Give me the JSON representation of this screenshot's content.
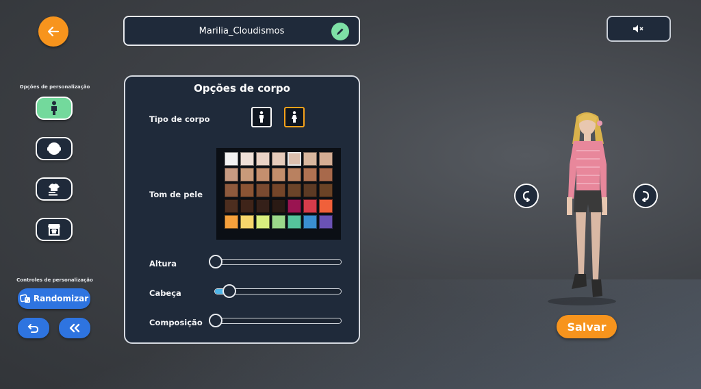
{
  "header": {
    "back_icon": "arrow-left-icon",
    "username": "Marilia_Cloudismos",
    "edit_icon": "pencil-icon",
    "mute_icon": "speaker-muted-icon"
  },
  "sidebar": {
    "options_title": "Opções de personalização",
    "items": [
      {
        "icon": "body-icon",
        "active": true
      },
      {
        "icon": "head-icon",
        "active": false
      },
      {
        "icon": "clothing-icon",
        "active": false
      },
      {
        "icon": "store-icon",
        "active": false
      }
    ],
    "controls_title": "Controles de personalização",
    "randomize_label": "Randomizar",
    "undo_icon": "undo-icon",
    "collapse_icon": "double-chevron-left-icon"
  },
  "panel": {
    "title": "Opções de corpo",
    "body_type_label": "Tipo de corpo",
    "body_types": [
      {
        "icon": "male-figure-icon",
        "selected": false
      },
      {
        "icon": "female-figure-icon",
        "selected": true
      }
    ],
    "skin_tone_label": "Tom de pele",
    "skin_tones": [
      "#f2f2f2",
      "#efe0d8",
      "#ead3c6",
      "#e5cbbb",
      "#dcbfae",
      "#d8b79f",
      "#d4ad94",
      "#c79b82",
      "#c99a7a",
      "#c58f6e",
      "#c28e6c",
      "#b98160",
      "#b07252",
      "#a8694b",
      "#8e5a3d",
      "#8b5434",
      "#7a4a30",
      "#744529",
      "#6b4429",
      "#5c3a24",
      "#6a4326",
      "#4d2e1f",
      "#3f2419",
      "#352019",
      "#2a1a14",
      "#9a1451",
      "#d63c4b",
      "#f0603a",
      "#f5a03c",
      "#f7d66b",
      "#d9ee7e",
      "#9bd88a",
      "#55c39c",
      "#3a8fd1",
      "#6a52b5"
    ],
    "selected_skin_index": 4,
    "height_label": "Altura",
    "height_value": 0,
    "head_label": "Cabeça",
    "head_value": 0.12,
    "build_label": "Composição",
    "build_value": 0
  },
  "preview": {
    "rotate_left_icon": "rotate-left-icon",
    "rotate_right_icon": "rotate-right-icon",
    "save_label": "Salvar"
  }
}
